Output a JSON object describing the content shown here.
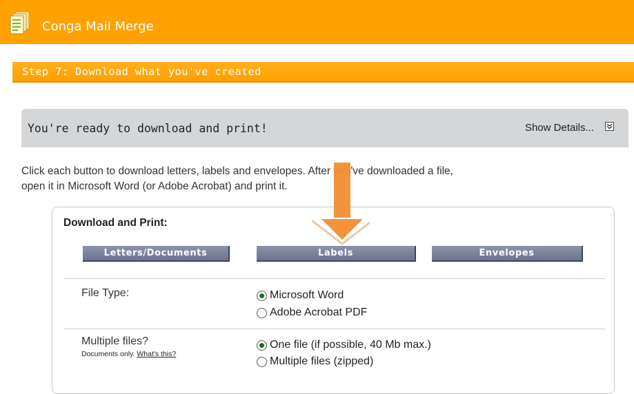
{
  "app": {
    "title": "Conga Mail Merge",
    "accent_color": "#ffa200",
    "icon": "documents-icon"
  },
  "step": {
    "title": "Step 7: Download what you've created"
  },
  "ready_panel": {
    "title": "You're ready to download and print!",
    "show_details_label": "Show Details...",
    "details_icon": "expand-chevron-icon"
  },
  "instructions": {
    "line1": "Click each button to download letters, labels and envelopes. After you've downloaded a file,",
    "line2": "open it in Microsoft Word (or Adobe Acrobat) and print it."
  },
  "download": {
    "title": "Download and Print:",
    "buttons": {
      "letters": "Letters/Documents",
      "labels": "Labels",
      "envelopes": "Envelopes"
    },
    "file_type": {
      "label": "File Type:",
      "options": [
        "Microsoft Word",
        "Adobe Acrobat PDF"
      ],
      "selected": "Microsoft Word"
    },
    "multiple_files": {
      "label": "Multiple files?",
      "note": "Documents only.",
      "help_link": "What's this?",
      "options": [
        "One file (if possible, 40 Mb max.)",
        "Multiple files (zipped)"
      ],
      "selected": "One file (if possible, 40 Mb max.)"
    }
  }
}
